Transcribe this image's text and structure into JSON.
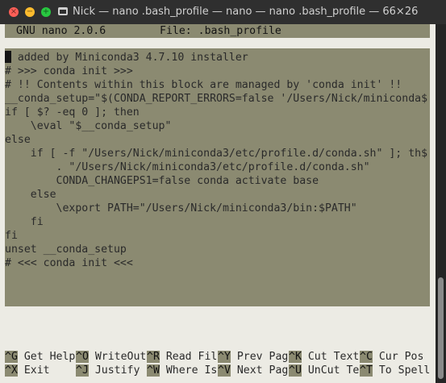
{
  "window": {
    "title": "Nick — nano .bash_profile — nano — nano .bash_profile — 66×26",
    "buttons": {
      "close": "×",
      "minimize": "−",
      "maximize": "+"
    }
  },
  "nano": {
    "version": "GNU nano 2.0.6",
    "file_label": "File: .bash_profile"
  },
  "editor": {
    "lines": [
      "# added by Miniconda3 4.7.10 installer",
      "# >>> conda init >>>",
      "# !! Contents within this block are managed by 'conda init' !!",
      "__conda_setup=\"$(CONDA_REPORT_ERRORS=false '/Users/Nick/miniconda$",
      "if [ $? -eq 0 ]; then",
      "    \\eval \"$__conda_setup\"",
      "else",
      "    if [ -f \"/Users/Nick/miniconda3/etc/profile.d/conda.sh\" ]; th$",
      "        . \"/Users/Nick/miniconda3/etc/profile.d/conda.sh\"",
      "        CONDA_CHANGEPS1=false conda activate base",
      "    else",
      "        \\export PATH=\"/Users/Nick/miniconda3/bin:$PATH\"",
      "    fi",
      "fi",
      "unset __conda_setup",
      "# <<< conda init <<<"
    ]
  },
  "shortcuts": {
    "row1": [
      {
        "key": "^G",
        "label": "Get Help"
      },
      {
        "key": "^O",
        "label": "WriteOut"
      },
      {
        "key": "^R",
        "label": "Read Fil"
      },
      {
        "key": "^Y",
        "label": "Prev Pag"
      },
      {
        "key": "^K",
        "label": "Cut Text"
      },
      {
        "key": "^C",
        "label": "Cur Pos"
      }
    ],
    "row2": [
      {
        "key": "^X",
        "label": "Exit"
      },
      {
        "key": "^J",
        "label": "Justify"
      },
      {
        "key": "^W",
        "label": "Where Is"
      },
      {
        "key": "^V",
        "label": "Next Pag"
      },
      {
        "key": "^U",
        "label": "UnCut Te"
      },
      {
        "key": "^T",
        "label": "To Spell"
      }
    ]
  },
  "colors": {
    "selection": "#8b8a71",
    "terminal_bg": "#ecebe4",
    "titlebar_bg": "#2f2f2f"
  }
}
